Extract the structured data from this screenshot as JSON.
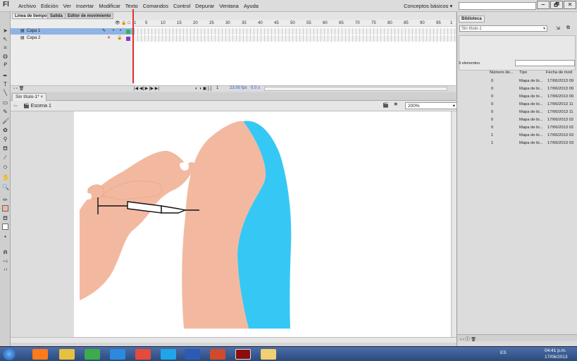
{
  "app": {
    "logo": "Fl",
    "workspace": "Conceptos básicos ▾",
    "window_buttons": [
      "‒",
      "🗗",
      "✕"
    ]
  },
  "menu": [
    "Archivo",
    "Edición",
    "Ver",
    "Insertar",
    "Modificar",
    "Texto",
    "Comandos",
    "Control",
    "Depurar",
    "Ventana",
    "Ayuda"
  ],
  "timeline": {
    "tabs": [
      "Línea de tiempo",
      "Salida",
      "Editor de movimiento"
    ],
    "layers": [
      {
        "name": "Capa 1",
        "color": "#2fb84a"
      },
      {
        "name": "Capa 2",
        "color": "#8a35c8"
      }
    ],
    "ruler": [
      "1",
      "5",
      "10",
      "15",
      "20",
      "25",
      "30",
      "35",
      "40",
      "45",
      "50",
      "55",
      "60",
      "65",
      "70",
      "75",
      "80",
      "85",
      "90",
      "95",
      "1"
    ],
    "current_frame": "1",
    "fps": "23.00 fps",
    "time": "0.0 s"
  },
  "document": {
    "tab": "Sin título-1*",
    "scene": "Escena 1",
    "zoom": "200%"
  },
  "library": {
    "title": "Biblioteca",
    "doc_select": "Sin título-1",
    "count": "9 elementos",
    "columns": [
      "Número de...",
      "Tipo",
      "Fecha de mod"
    ],
    "rows": [
      {
        "num": "0",
        "type": "Mapa de bi...",
        "date": "17/06/2013 09"
      },
      {
        "num": "0",
        "type": "Mapa de bi...",
        "date": "17/06/2013 09"
      },
      {
        "num": "0",
        "type": "Mapa de bi...",
        "date": "17/06/2013 09"
      },
      {
        "num": "0",
        "type": "Mapa de bi...",
        "date": "17/06/2013 11"
      },
      {
        "num": "0",
        "type": "Mapa de bi...",
        "date": "17/06/2013 11"
      },
      {
        "num": "0",
        "type": "Mapa de bi...",
        "date": "17/06/2013 02"
      },
      {
        "num": "0",
        "type": "Mapa de bi...",
        "date": "17/06/2013 02"
      },
      {
        "num": "1",
        "type": "Mapa de bi...",
        "date": "17/06/2013 03"
      },
      {
        "num": "1",
        "type": "Mapa de bi...",
        "date": "17/06/2013 03"
      }
    ]
  },
  "taskbar": {
    "lang": "ES",
    "time": "04:41 p.m.",
    "date": "17/06/2013"
  },
  "colors": {
    "skin": "#f2b9a0",
    "shirt": "#36c8f4",
    "playhead": "#e03030"
  }
}
